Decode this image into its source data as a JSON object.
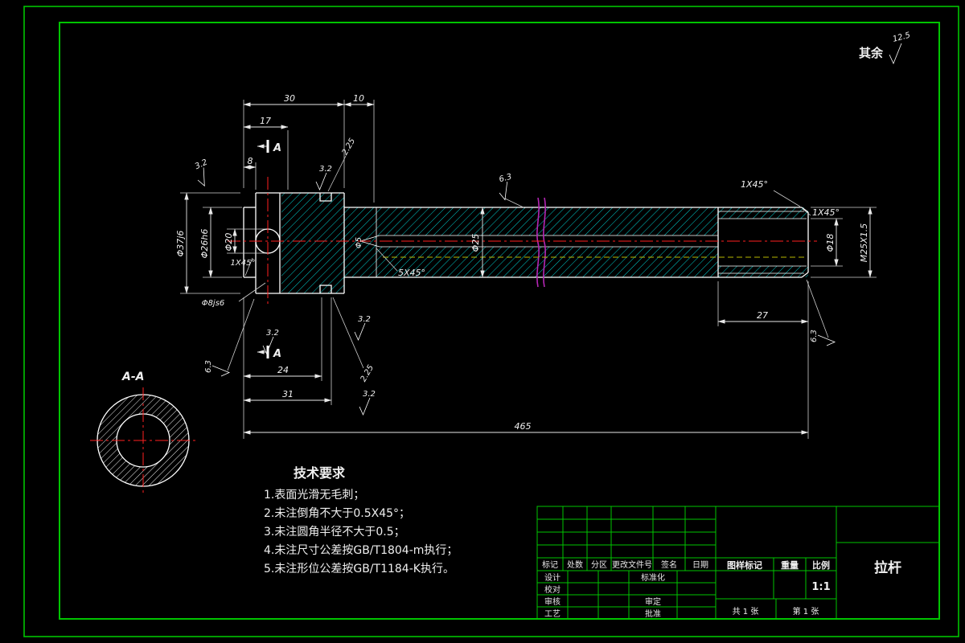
{
  "colors": {
    "background": "#000000",
    "frame": "#00c400",
    "lines": "#ffffff",
    "hatch": "#00cccc",
    "centerline": "#ff2020",
    "hidden_line": "#b9b900",
    "break_line": "#b526b5"
  },
  "corner_note": {
    "label": "其余",
    "value": "12.5"
  },
  "finish": {
    "f32": "3.2",
    "f63": "6.3"
  },
  "dims": {
    "len30": "30",
    "len10": "10",
    "len17": "17",
    "len8": "8",
    "groove_top": "2.25",
    "groove_bottom": "2.25",
    "chamfer_top_right": "1X45°",
    "chamfer_right": "1X45°",
    "chamfer_left": "1X45°",
    "chamfer_bore": "5X45°",
    "dia37": "Φ37j6",
    "dia26": "Φ26h6",
    "dia20": "Φ20",
    "dia8": "Φ8js6",
    "dia25": "Φ25",
    "dia5": "Φ5",
    "dia18": "Φ18",
    "thread": "M25X1.5",
    "len24": "24",
    "len31": "31",
    "len465": "465",
    "len27": "27"
  },
  "section": {
    "mark_top": "A",
    "mark_bottom": "A",
    "view_label": "A-A"
  },
  "tech": {
    "title": "技术要求",
    "items": [
      "1.表面光滑无毛刺；",
      "2.未注倒角不大于0.5X45°；",
      "3.未注圆角半径不大于0.5；",
      "4.未注尺寸公差按GB/T1804-m执行；",
      "5.未注形位公差按GB/T1184-K执行。"
    ]
  },
  "title_block": {
    "headers": [
      "标记",
      "处数",
      "分区",
      "更改文件号",
      "签名",
      "日期"
    ],
    "row_labels": [
      "设计",
      "校对",
      "审核",
      "工艺"
    ],
    "mid_labels": [
      "标准化",
      "",
      "审定",
      "批准"
    ],
    "mark_header": "图样标记",
    "weight_header": "重量",
    "scale_header": "比例",
    "scale_value": "1:1",
    "sheets_total": "共 1 张",
    "sheet_no": "第 1 张",
    "part_name": "拉杆"
  }
}
